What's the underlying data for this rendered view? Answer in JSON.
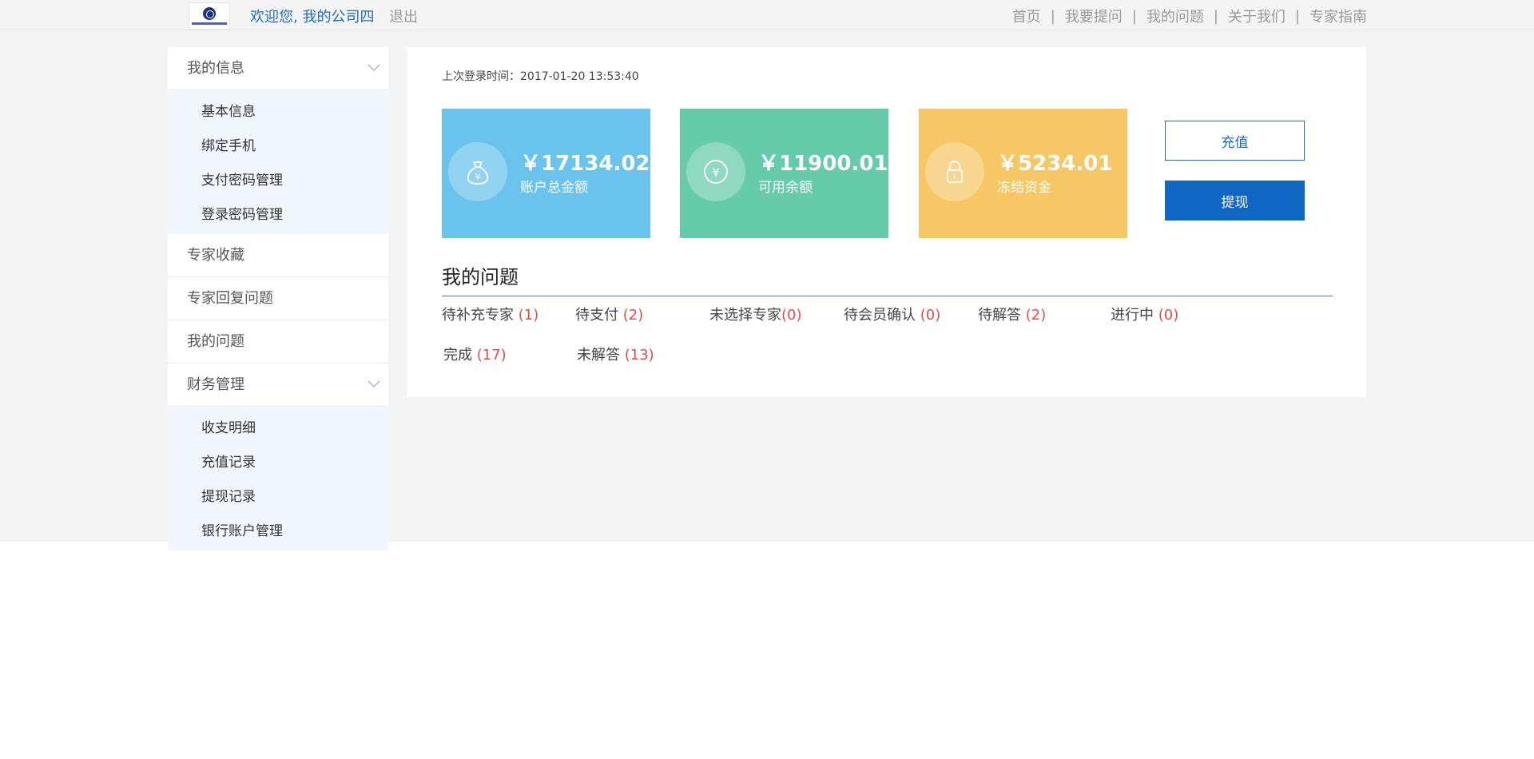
{
  "header": {
    "welcome": "欢迎您, 我的公司四",
    "logout": "退出",
    "nav": [
      "首页",
      "我要提问",
      "我的问题",
      "关于我们",
      "专家指南"
    ],
    "separator": "|"
  },
  "sidebar": {
    "my_info": {
      "label": "我的信息",
      "items": [
        "基本信息",
        "绑定手机",
        "支付密码管理",
        "登录密码管理"
      ]
    },
    "expert_fav": "专家收藏",
    "expert_reply": "专家回复问题",
    "my_questions": "我的问题",
    "finance": {
      "label": "财务管理",
      "items": [
        "收支明细",
        "充值记录",
        "提现记录",
        "银行账户管理"
      ]
    }
  },
  "main": {
    "last_login": "上次登录时间：2017-01-20 13:53:40",
    "cards": [
      {
        "amount": "￥17134.02",
        "label": "账户总金额",
        "icon": "money-bag-icon",
        "color": "#69c3ec"
      },
      {
        "amount": "￥11900.01",
        "label": "可用余额",
        "icon": "yen-coin-icon",
        "color": "#65cba9"
      },
      {
        "amount": "￥5234.01",
        "label": "冻结资金",
        "icon": "lock-icon",
        "color": "#f7c765"
      }
    ],
    "recharge_label": "充值",
    "withdraw_label": "提现",
    "questions_title": "我的问题",
    "question_status": [
      {
        "label": "待补充专家 ",
        "count": "(1)"
      },
      {
        "label": "待支付 ",
        "count": "(2)"
      },
      {
        "label": "未选择专家",
        "count": "(0)"
      },
      {
        "label": "待会员确认 ",
        "count": "(0)"
      },
      {
        "label": "待解答 ",
        "count": "(2)"
      },
      {
        "label": "进行中 ",
        "count": "(0)"
      },
      {
        "label": "完成 ",
        "count": "(17)"
      },
      {
        "label": "未解答 ",
        "count": "(13)"
      }
    ]
  }
}
